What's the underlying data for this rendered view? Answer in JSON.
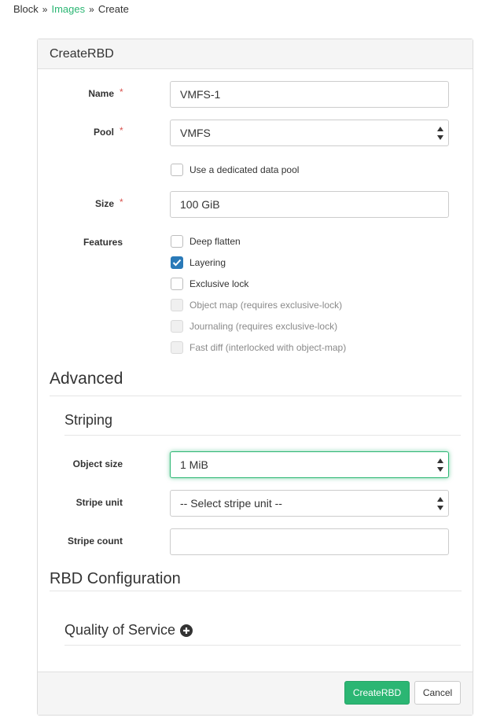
{
  "breadcrumb": {
    "items": [
      "Block",
      "Images",
      "Create"
    ]
  },
  "panel": {
    "title": "CreateRBD"
  },
  "form": {
    "name": {
      "label": "Name",
      "value": "VMFS-1"
    },
    "pool": {
      "label": "Pool",
      "value": "VMFS"
    },
    "data_pool": {
      "label": "Use a dedicated data pool",
      "checked": false
    },
    "size": {
      "label": "Size",
      "value": "100 GiB"
    },
    "features": {
      "label": "Features",
      "items": [
        {
          "label": "Deep flatten",
          "checked": false,
          "disabled": false
        },
        {
          "label": "Layering",
          "checked": true,
          "disabled": false
        },
        {
          "label": "Exclusive lock",
          "checked": false,
          "disabled": false
        },
        {
          "label": "Object map (requires exclusive-lock)",
          "checked": false,
          "disabled": true
        },
        {
          "label": "Journaling (requires exclusive-lock)",
          "checked": false,
          "disabled": true
        },
        {
          "label": "Fast diff (interlocked with object-map)",
          "checked": false,
          "disabled": true
        }
      ]
    }
  },
  "advanced": {
    "title": "Advanced",
    "striping": {
      "title": "Striping",
      "object_size": {
        "label": "Object size",
        "value": "1 MiB"
      },
      "stripe_unit": {
        "label": "Stripe unit",
        "value": "-- Select stripe unit --"
      },
      "stripe_count": {
        "label": "Stripe count",
        "value": ""
      }
    }
  },
  "rbd_config": {
    "title": "RBD Configuration",
    "qos": {
      "title": "Quality of Service"
    }
  },
  "footer": {
    "submit_label": "CreateRBD",
    "cancel_label": "Cancel"
  },
  "colors": {
    "accent": "#2bb673",
    "checkbox_checked": "#2a7ab8",
    "required": "#d9534f"
  },
  "icons": {
    "breadcrumb_separator": "double-chevron-right-icon",
    "qos_toggle": "plus-circle-icon"
  }
}
